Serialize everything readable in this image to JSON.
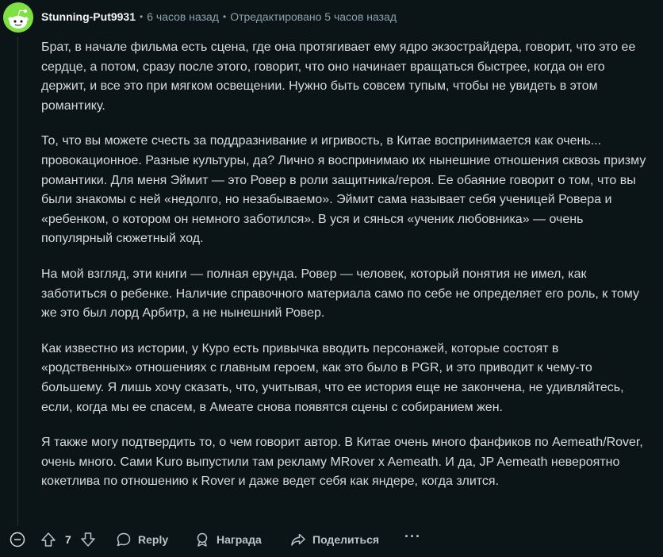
{
  "comment": {
    "author": "Stunning-Put9931",
    "posted": "6 часов назад",
    "edited": "Отредактировано 5 часов назад",
    "meta_separator": "•",
    "paragraphs": [
      "Брат, в начале фильма есть сцена, где она протягивает ему ядро экзостpайдера, говорит, что это ее сердце, а потом, сразу после этого, говорит, что оно начинает вращаться быстрее, когда он его держит, и все это при мягком освещении. Нужно быть совсем тупым, чтобы не увидеть в этом романтику.",
      "То, что вы можете счесть за поддразнивание и игривость, в Китае воспринимается как очень... провокационное. Разные культуры, да? Лично я воспринимаю их нынешние отношения сквозь призму романтики. Для меня Эймит — это Ровер в роли защитника/героя. Ее обаяние говорит о том, что вы были знакомы с ней «недолго, но незабываемо». Эймит сама называет себя ученицей Ровера и «ребенком, о котором он немного заботился». В уся и сянься «ученик любовника» — очень популярный сюжетный ход.",
      "На мой взгляд, эти книги — полная ерунда. Ровер — человек, который понятия не имел, как заботиться о ребенке. Наличие справочного материала само по себе не определяет его роль, к тому же это был лорд Арбитр, а не нынешний Ровер.",
      "Как известно из истории, у Куро есть привычка вводить персонажей, которые состоят в «родственных» отношениях с главным героем, как это было в PGR, и это приводит к чему-то большему. Я лишь хочу сказать, что, учитывая, что ее история еще не закончена, не удивляйтесь, если, когда мы ее спасем, в Амеате снова появятся сцены с собиранием жен.",
      "Я также могу подтвердить то, о чем говорит автор. В Китае очень много фанфиков по Aemeath/Rover, очень много. Сами Kuro выпустили там рекламу MRover x Aemeath. И да, JP Aemeath невероятно кокетлива по отношению к Rover и даже ведет себя как яндере, когда злится."
    ]
  },
  "actions": {
    "vote_count": "7",
    "reply_label": "Reply",
    "award_label": "Награда",
    "share_label": "Поделиться",
    "more_label": "···"
  },
  "icons": {
    "collapse": "minus-circle-icon",
    "upvote": "arrow-up-icon",
    "downvote": "arrow-down-icon",
    "reply": "speech-bubble-icon",
    "award": "award-icon",
    "share": "share-arrow-icon",
    "avatar": "snoo-avatar-icon"
  },
  "colors": {
    "background": "#0b1416",
    "avatar": "#7ee042",
    "text": "#d7dadc",
    "meta": "#8ba2ad"
  }
}
